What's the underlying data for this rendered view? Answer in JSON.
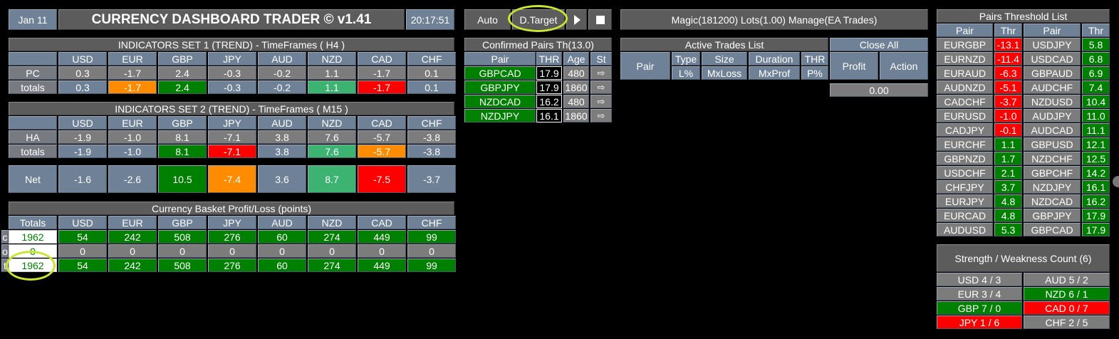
{
  "topbar": {
    "date": "Jan 11",
    "title": "CURRENCY DASHBOARD TRADER © v1.41",
    "time": "20:17:51",
    "auto": "Auto",
    "target": "D.Target",
    "play_icon": "play-icon",
    "stop_icon": "stop-icon",
    "info": "Magic(181200)  Lots(1.00)  Manage(EA Trades)"
  },
  "colors": {
    "accent_green": "#008000",
    "light_green": "#3cb371",
    "red": "#ff0000",
    "orange": "#ff8c00",
    "cell_bg": "#6f8196"
  },
  "currencies": [
    "USD",
    "EUR",
    "GBP",
    "JPY",
    "AUD",
    "NZD",
    "CAD",
    "CHF"
  ],
  "set1": {
    "title": "INDICATORS SET 1 (TREND) - TimeFrames ( H4 )",
    "row1_label": "PC",
    "row2_label": "totals",
    "row1": [
      "0.3",
      "-1.7",
      "2.4",
      "-0.3",
      "-0.2",
      "1.1",
      "-1.7",
      "0.1"
    ],
    "row2": [
      "0.3",
      "-1.7",
      "2.4",
      "-0.3",
      "-0.2",
      "1.1",
      "-1.7",
      "0.1"
    ]
  },
  "set2": {
    "title": "INDICATORS SET 2 (TREND) - TimeFrames ( M15 )",
    "row1_label": "HA",
    "row2_label": "totals",
    "row1": [
      "-1.9",
      "-1.0",
      "8.1",
      "-7.1",
      "3.8",
      "7.6",
      "-5.7",
      "-3.8"
    ],
    "row2": [
      "-1.9",
      "-1.0",
      "8.1",
      "-7.1",
      "3.8",
      "7.6",
      "-5.7",
      "-3.8"
    ]
  },
  "net": {
    "label": "Net",
    "values": [
      "-1.6",
      "-2.6",
      "10.5",
      "-7.4",
      "3.6",
      "8.7",
      "-7.5",
      "-3.7"
    ]
  },
  "basket": {
    "title": "Currency Basket Profit/Loss (points)",
    "totals_header": "Totals",
    "rows": [
      {
        "tag": "c",
        "total": "1962",
        "values": [
          "54",
          "242",
          "508",
          "276",
          "60",
          "274",
          "449",
          "99"
        ]
      },
      {
        "tag": "o",
        "total": "0",
        "values": [
          "0",
          "0",
          "0",
          "0",
          "0",
          "0",
          "0",
          "0"
        ]
      },
      {
        "tag": "t",
        "total": "1962",
        "values": [
          "54",
          "242",
          "508",
          "276",
          "60",
          "274",
          "449",
          "99"
        ]
      }
    ]
  },
  "confirmed": {
    "title": "Confirmed Pairs Th(13.0)",
    "headers": [
      "Pair",
      "THR",
      "Age",
      "St"
    ],
    "rows": [
      {
        "pair": "GBPCAD",
        "thr": "17.9",
        "age": "480"
      },
      {
        "pair": "GBPJPY",
        "thr": "17.9",
        "age": "1860"
      },
      {
        "pair": "NZDCAD",
        "thr": "16.2",
        "age": "480"
      },
      {
        "pair": "NZDJPY",
        "thr": "16.1",
        "age": "1860"
      }
    ],
    "status_icon": "arrow-right-icon"
  },
  "trades": {
    "title": "Active Trades List",
    "pair": "Pair",
    "type": "Type",
    "size": "Size",
    "duration": "Duration",
    "thr": "THR",
    "lp": "L%",
    "mxloss": "MxLoss",
    "mxprof": "MxProf",
    "pp": "P%",
    "close_all": "Close All",
    "profit": "Profit",
    "action": "Action",
    "total": "0.00"
  },
  "threshold": {
    "title": "Pairs Threshold List",
    "headers": [
      "Pair",
      "Thr",
      "Pair",
      "Thr"
    ],
    "left": [
      [
        "EURGBP",
        "-13.1"
      ],
      [
        "EURNZD",
        "-11.4"
      ],
      [
        "EURAUD",
        "-6.3"
      ],
      [
        "AUDNZD",
        "-5.1"
      ],
      [
        "CADCHF",
        "-3.7"
      ],
      [
        "EURUSD",
        "-1.0"
      ],
      [
        "CADJPY",
        "-0.1"
      ],
      [
        "EURCHF",
        "1.1"
      ],
      [
        "GBPNZD",
        "1.7"
      ],
      [
        "USDCHF",
        "2.1"
      ],
      [
        "CHFJPY",
        "3.7"
      ],
      [
        "EURJPY",
        "4.8"
      ],
      [
        "EURCAD",
        "4.8"
      ],
      [
        "AUDUSD",
        "5.3"
      ]
    ],
    "right": [
      [
        "USDJPY",
        "5.8"
      ],
      [
        "USDCAD",
        "6.8"
      ],
      [
        "GBPAUD",
        "6.9"
      ],
      [
        "AUDCHF",
        "7.4"
      ],
      [
        "NZDUSD",
        "10.4"
      ],
      [
        "AUDJPY",
        "11.0"
      ],
      [
        "AUDCAD",
        "11.1"
      ],
      [
        "GBPUSD",
        "12.1"
      ],
      [
        "NZDCHF",
        "12.5"
      ],
      [
        "GBPCHF",
        "14.2"
      ],
      [
        "NZDJPY",
        "16.1"
      ],
      [
        "NZDCAD",
        "16.2"
      ],
      [
        "GBPJPY",
        "17.9"
      ],
      [
        "GBPCAD",
        "17.9"
      ]
    ]
  },
  "strength": {
    "title": "Strength / Weakness Count (6)",
    "left": [
      "USD 4 / 3",
      "EUR 3 / 4",
      "GBP 7 / 0",
      "JPY 1 / 6"
    ],
    "right": [
      "AUD 5 / 2",
      "NZD 6 / 1",
      "CAD 0 / 7",
      "CHF 2 / 5"
    ]
  }
}
